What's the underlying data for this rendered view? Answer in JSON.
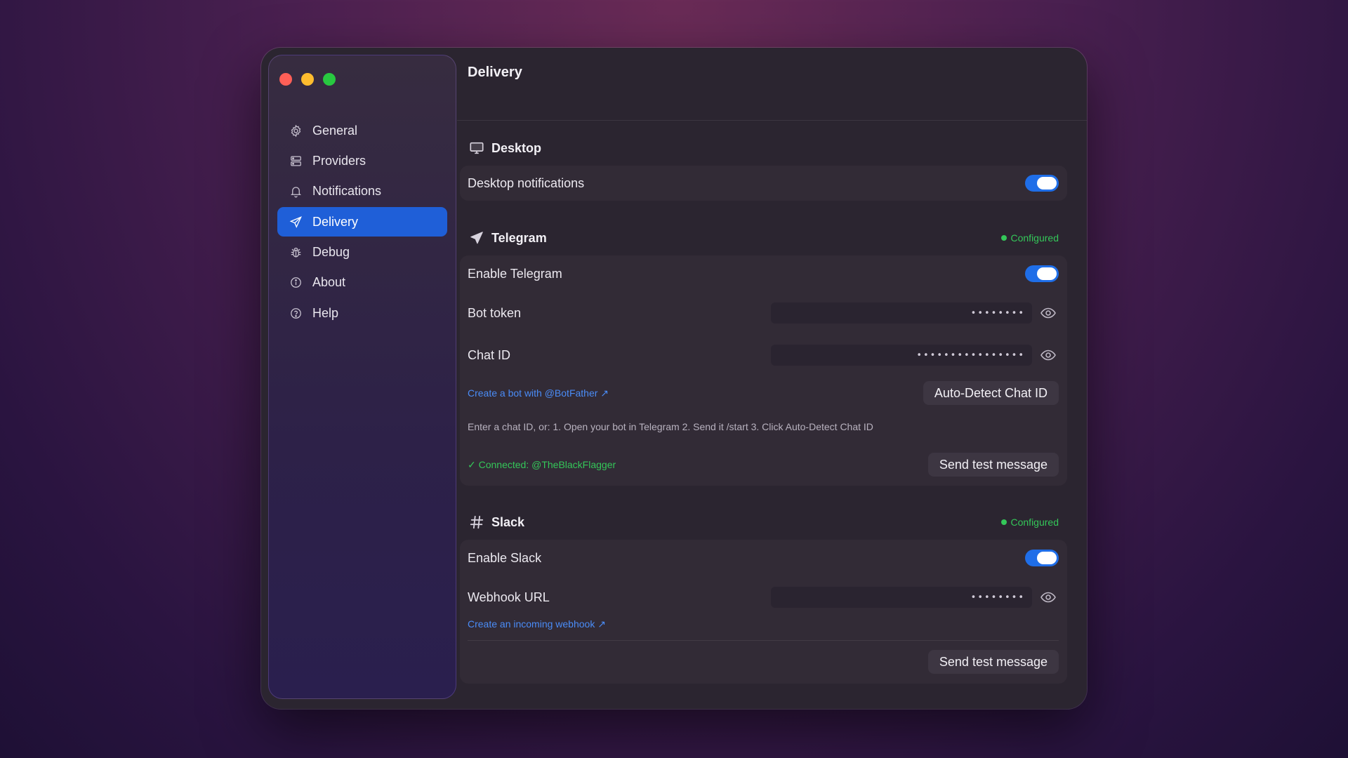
{
  "window": {
    "title": "Delivery"
  },
  "sidebar": {
    "items": [
      {
        "label": "General",
        "icon": "gear-icon"
      },
      {
        "label": "Providers",
        "icon": "server-icon"
      },
      {
        "label": "Notifications",
        "icon": "bell-icon"
      },
      {
        "label": "Delivery",
        "icon": "paper-plane-icon",
        "active": true
      },
      {
        "label": "Debug",
        "icon": "bug-icon"
      },
      {
        "label": "About",
        "icon": "info-icon"
      },
      {
        "label": "Help",
        "icon": "question-icon"
      }
    ]
  },
  "desktop": {
    "title": "Desktop",
    "notifications_label": "Desktop notifications",
    "notifications_enabled": true
  },
  "telegram": {
    "title": "Telegram",
    "status": "Configured",
    "enable_label": "Enable Telegram",
    "enabled": true,
    "bot_token_label": "Bot token",
    "bot_token_value": "••••••••",
    "chat_id_label": "Chat ID",
    "chat_id_value": "••••••••••••••••",
    "botfather_link": "Create a bot with @BotFather ↗",
    "auto_detect_button": "Auto-Detect Chat ID",
    "hint": "Enter a chat ID, or: 1. Open your bot in Telegram  2. Send it /start  3. Click Auto-Detect Chat ID",
    "connected_text": "✓ Connected: @TheBlackFlagger",
    "send_test_button": "Send test message"
  },
  "slack": {
    "title": "Slack",
    "status": "Configured",
    "enable_label": "Enable Slack",
    "enabled": true,
    "webhook_label": "Webhook URL",
    "webhook_value": "••••••••",
    "webhook_link": "Create an incoming webhook ↗",
    "send_test_button": "Send test message"
  },
  "colors": {
    "accent": "#1f5fd8",
    "toggle_on": "#1f6ee8",
    "status_green": "#34c759",
    "link_blue": "#4a8cf7"
  }
}
